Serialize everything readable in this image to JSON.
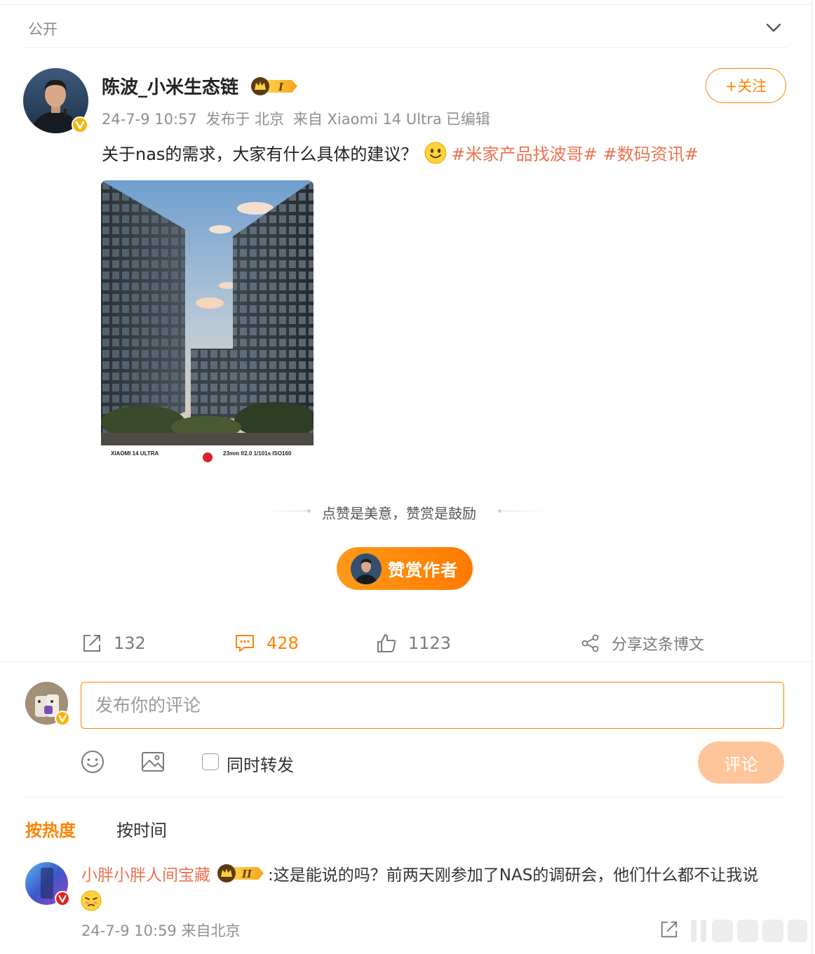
{
  "visibility": {
    "label": "公开"
  },
  "post": {
    "author": "陈波_小米生态链",
    "vip_level": "I",
    "follow_label": "+关注",
    "time": "24-7-9 10:57",
    "location": "发布于 北京",
    "source": "来自 Xiaomi 14 Ultra",
    "edited": "已编辑",
    "text": "关于nas的需求，大家有什么具体的建议？",
    "hashtags": [
      "#米家产品找波哥#",
      "#数码资讯#"
    ],
    "photo": {
      "exif_left": "XIAOMI 14 ULTRA",
      "exif_right": "23mm  f/2.0  1/101s  ISO160"
    }
  },
  "reward": {
    "slogan": "点赞是美意，赞赏是鼓励",
    "button_label": "赞赏作者"
  },
  "actions": {
    "reposts": "132",
    "comments": "428",
    "likes": "1123",
    "share_label": "分享这条博文"
  },
  "composer": {
    "placeholder": "发布你的评论",
    "repost_label": "同时转发",
    "submit_label": "评论"
  },
  "sort_tabs": {
    "hot": "按热度",
    "time": "按时间"
  },
  "comments": [
    {
      "author": "小胖小胖人间宝藏",
      "vip_level": "II",
      "text": ":这是能说的吗？前两天刚参加了NAS的调研会，他们什么都不让我说",
      "time": "24-7-9 10:59",
      "source": "来自北京"
    }
  ],
  "colors": {
    "accent": "#ff8200",
    "link": "#eb7350",
    "muted": "#8f8f8f",
    "submit_disabled": "#ffc59a"
  }
}
